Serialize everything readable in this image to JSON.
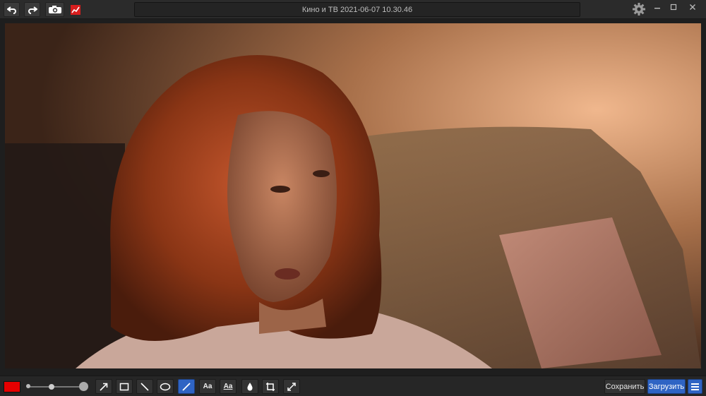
{
  "window": {
    "title": "Кино и ТВ 2021-06-07 10.30.46",
    "controls": [
      "minimize-icon",
      "maximize-icon",
      "close-icon"
    ]
  },
  "titlebar": {
    "buttons": [
      {
        "name": "undo-button",
        "icon": "undo-icon"
      },
      {
        "name": "redo-button",
        "icon": "redo-icon"
      },
      {
        "name": "capture-button",
        "icon": "camera-icon"
      },
      {
        "name": "chart-button",
        "icon": "chart-icon"
      }
    ],
    "settings_icon": "gear-icon"
  },
  "canvas": {
    "image_subject": "screenshot"
  },
  "toolbar": {
    "color": "#e60000",
    "accent": "#2f64c4",
    "brush_size_fraction": 0.42,
    "tools": [
      {
        "name": "arrow",
        "icon": "arrow-icon",
        "label": ""
      },
      {
        "name": "rectangle",
        "icon": "rectangle-icon",
        "label": ""
      },
      {
        "name": "line",
        "icon": "line-icon",
        "label": ""
      },
      {
        "name": "ellipse",
        "icon": "ellipse-icon",
        "label": ""
      },
      {
        "name": "pen",
        "icon": "pen-icon",
        "label": "",
        "active": true
      },
      {
        "name": "text",
        "icon": "text-icon",
        "label": "Aa"
      },
      {
        "name": "text-outline",
        "icon": "text-outline-icon",
        "label": "Aa"
      },
      {
        "name": "blur",
        "icon": "drop-icon",
        "label": ""
      },
      {
        "name": "crop",
        "icon": "crop-icon",
        "label": ""
      },
      {
        "name": "resize",
        "icon": "resize-icon",
        "label": ""
      }
    ],
    "save_label": "Сохранить",
    "upload_label": "Загрузить"
  }
}
